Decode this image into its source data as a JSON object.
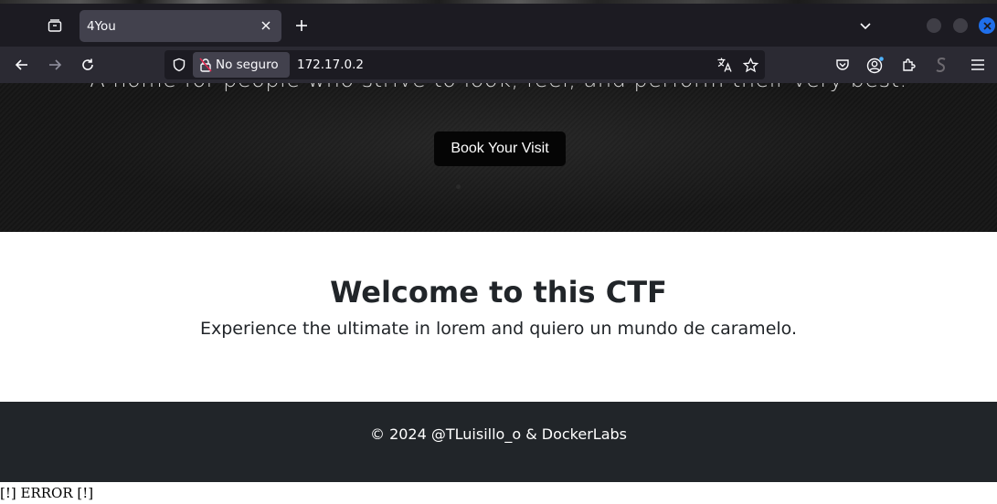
{
  "browser": {
    "tab": {
      "title": "4You"
    },
    "address": {
      "security_label": "No seguro",
      "url": "172.17.0.2"
    }
  },
  "hero": {
    "tagline": "A home for people who strive to look, feel, and perform their very best.",
    "button_label": "Book Your Visit"
  },
  "welcome": {
    "title": "Welcome to this CTF",
    "subtitle": "Experience the ultimate in lorem and quiero un mundo de caramelo."
  },
  "footer": {
    "copyright": "© 2024 @TLuisillo_o & DockerLabs"
  },
  "error_text": "[!] ERROR [!]",
  "colors": {
    "chrome_dark": "#1c1b22",
    "navbar": "#2b2a33",
    "footer_bg": "#212529",
    "close_blue": "#1f6feb"
  },
  "icons": [
    "tab-list-icon",
    "close-icon",
    "plus-icon",
    "chevron-down-icon",
    "back-arrow-icon",
    "forward-arrow-icon",
    "reload-icon",
    "shield-icon",
    "lock-slash-icon",
    "translate-icon",
    "star-icon",
    "pocket-icon",
    "account-icon",
    "extensions-icon",
    "extension-s-icon",
    "hamburger-menu-icon"
  ]
}
